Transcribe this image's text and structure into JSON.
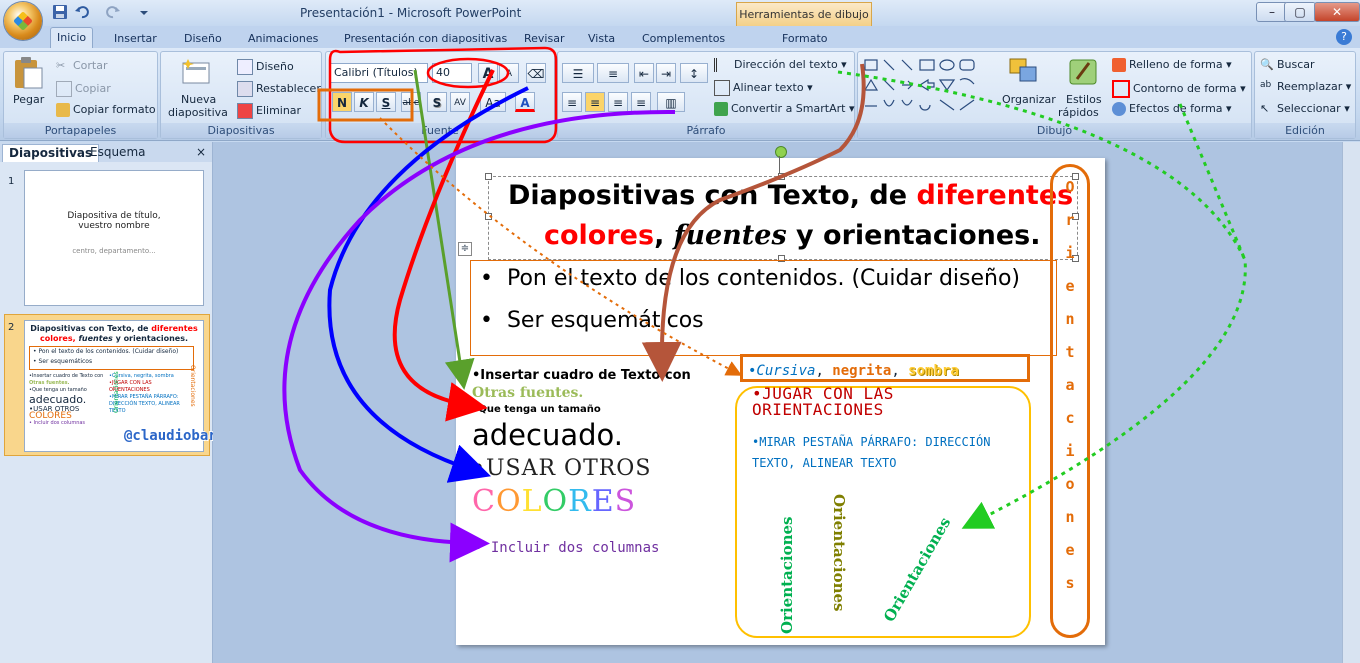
{
  "window": {
    "title": "Presentación1 - Microsoft PowerPoint",
    "context_tab": "Herramientas de dibujo",
    "min": "–",
    "max": "▢",
    "close": "✕"
  },
  "tabs": [
    "Inicio",
    "Insertar",
    "Diseño",
    "Animaciones",
    "Presentación con diapositivas",
    "Revisar",
    "Vista",
    "Complementos",
    "Formato"
  ],
  "ribbon": {
    "portapapeles": {
      "label": "Portapapeles",
      "pegar": "Pegar",
      "cortar": "Cortar",
      "copiar": "Copiar",
      "copiar_formato": "Copiar formato"
    },
    "diapositivas": {
      "label": "Diapositivas",
      "nueva_1": "Nueva",
      "nueva_2": "diapositiva",
      "diseno": "Diseño",
      "restablecer": "Restablecer",
      "eliminar": "Eliminar"
    },
    "fuente": {
      "label": "Fuente",
      "font_name": "Calibri (Títulos)",
      "font_size": "40",
      "grow": "A",
      "shrink": "A",
      "bold": "N",
      "italic": "K",
      "underline": "S",
      "strike": "abe",
      "shadow": "S",
      "spacing": "AV",
      "case": "Aa",
      "color": "A"
    },
    "parrafo": {
      "label": "Párrafo",
      "direccion": "Dirección del texto",
      "alinear": "Alinear texto",
      "smartart": "Convertir a SmartArt"
    },
    "dibujo": {
      "label": "Dibujo",
      "organizar": "Organizar",
      "estilos_1": "Estilos",
      "estilos_2": "rápidos",
      "relleno": "Relleno de forma",
      "contorno": "Contorno de forma",
      "efectos": "Efectos de forma"
    },
    "edicion": {
      "label": "Edición",
      "buscar": "Buscar",
      "reemplazar": "Reemplazar",
      "seleccionar": "Seleccionar"
    }
  },
  "panel": {
    "tab_diapositivas": "Diapositivas",
    "tab_esquema": "Esquema",
    "close": "×",
    "slide1": {
      "num": "1",
      "title_1": "Diapositiva de título,",
      "title_2": "vuestro nombre",
      "subtitle": "centro, departamento..."
    },
    "slide2": {
      "num": "2",
      "t1": "Diapositivas con Texto, de",
      "t1r": "diferentes",
      "t2a": "colores,",
      "t2b": "fuentes",
      "t2c": "y orientaciones.",
      "b1": "• Pon el texto de los contenidos. (Cuidar diseño)",
      "b2": "• Ser esquemáticos",
      "m1": "•Insertar cuadro de Texto con",
      "m2": "Otras fuentes.",
      "m3": "•Que tenga un tamaño",
      "m4": "adecuado.",
      "m5": "•USAR OTROS",
      "m6": "COLORES",
      "m7": "• Incluir dos columnas",
      "r1": "•Cursiva, negrita, sombra",
      "r2": "•JUGAR CON LAS ORIENTACIONES",
      "r3": "•MIRAR PESTAÑA PÁRRAFO: DIRECCIÓN TEXTO, ALINEAR TEXTO",
      "ov": "Orientaciones",
      "o1": "Orientaciones"
    }
  },
  "watermark": "@claudiobarrabes",
  "slide": {
    "title_l1_a": "Diapositivas con Texto, de ",
    "title_l1_b": "diferentes",
    "title_l2_a": "colores",
    "title_l2_b": ", ",
    "title_l2_c": "fuentes",
    "title_l2_d": " y orientaciones.",
    "bullet_1": "Pon el texto de los contenidos. (Cuidar diseño)",
    "bullet_2": "Ser esquemáticos",
    "left_1": "•Insertar cuadro de Texto con",
    "left_2": "Otras fuentes.",
    "left_3": "•Que tenga un tamaño",
    "left_4": "adecuado.",
    "left_5": "•USAR OTROS",
    "left_6": [
      "C",
      "O",
      "L",
      "O",
      "R",
      "E",
      "S"
    ],
    "left_7": "• Incluir dos columnas",
    "right_1_a": "•Cursiva",
    "right_1_b": ", ",
    "right_1_c": "negrita",
    "right_1_d": ", ",
    "right_1_e": "sombra",
    "right_2": "•JUGAR CON LAS ORIENTACIONES",
    "right_3": "•MIRAR PESTAÑA PÁRRAFO: DIRECCIÓN TEXTO, ALINEAR TEXTO",
    "vert_1": "Orientaciones",
    "vert_2": "Orientaciones",
    "vert_3": "Orientaciones",
    "vertical_stack": [
      "O",
      "r",
      "i",
      "e",
      "n",
      "t",
      "a",
      "c",
      "i",
      "o",
      "n",
      "e",
      "s"
    ]
  },
  "colors": {
    "accent": "#e36c09",
    "red": "#ff0000",
    "green": "#00b050",
    "olive": "#7f7f00",
    "blue": "#0070c0",
    "purple": "#7030a0",
    "yellow": "#ffcc33"
  }
}
